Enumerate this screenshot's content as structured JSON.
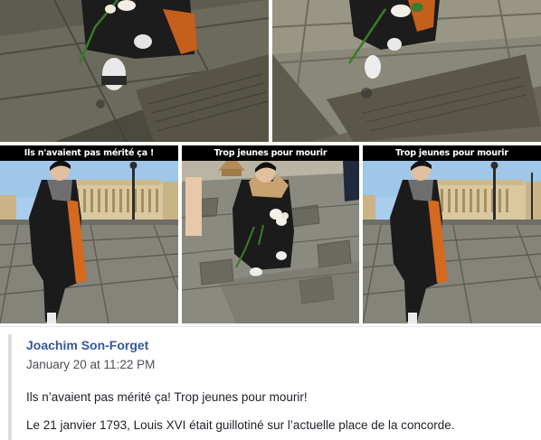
{
  "photos": [
    {
      "caption": ""
    },
    {
      "caption": ""
    },
    {
      "caption": "Ils n'avaient pas mérité ça !"
    },
    {
      "caption": "Trop jeunes pour mourir"
    },
    {
      "caption": "Trop jeunes pour mourir"
    }
  ],
  "post": {
    "author": "Joachim Son-Forget",
    "timestamp": "January 20 at 11:22 PM",
    "lines": [
      "Ils n’avaient pas mérité ça! Trop jeunes pour mourir!",
      "Le 21 janvier 1793, Louis XVI était guillotiné sur l’actuelle place de la concorde."
    ]
  },
  "colors": {
    "author_link": "#365899",
    "caption_bar": "#000000",
    "sky": "#9ec7ea",
    "pavement": "#6d6a5c",
    "coat": "#1b1b1b",
    "scarf": "#d4691f"
  }
}
